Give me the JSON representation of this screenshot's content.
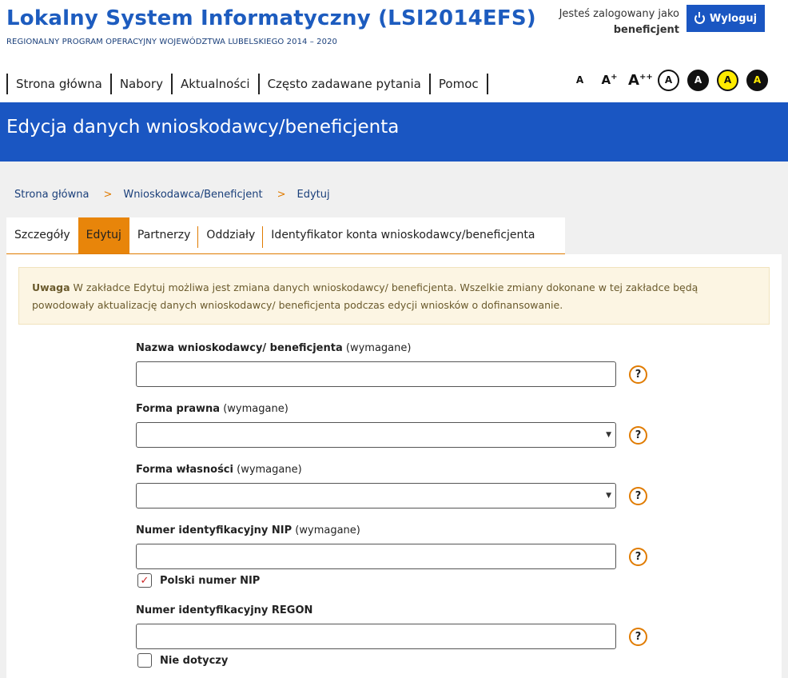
{
  "header": {
    "title": "Lokalny System Informatyczny (LSI2014EFS)",
    "subtitle": "REGIONALNY PROGRAM OPERACYJNY WOJEWÓDZTWA LUBELSKIEGO 2014 – 2020",
    "logged_in_label": "Jesteś zalogowany jako",
    "username": "beneficjent",
    "logout_label": "Wyloguj"
  },
  "nav": {
    "items": [
      "Strona główna",
      "Nabory",
      "Aktualności",
      "Często zadawane pytania",
      "Pomoc"
    ]
  },
  "accessibility": {
    "font_small": "A",
    "font_medium": "A",
    "font_medium_sup": "+",
    "font_large": "A",
    "font_large_sup": "++",
    "contrast": [
      "A",
      "A",
      "A",
      "A"
    ]
  },
  "banner": {
    "title": "Edycja danych wnioskodawcy/beneficjenta"
  },
  "breadcrumb": {
    "items": [
      "Strona główna",
      "Wnioskodawca/Beneficjent",
      "Edytuj"
    ],
    "separator": ">"
  },
  "tabs": {
    "items": [
      "Szczegóły",
      "Edytuj",
      "Partnerzy",
      "Oddziały",
      "Identyfikator konta wnioskodawcy/beneficjenta"
    ],
    "active": "Edytuj"
  },
  "alert": {
    "strong": "Uwaga",
    "text": " W zakładce Edytuj możliwa jest zmiana danych wnioskodawcy/ beneficjenta. Wszelkie zmiany dokonane w tej zakładce będą powodowały aktualizację danych wnioskodawcy/ beneficjenta podczas edycji wniosków o dofinansowanie."
  },
  "form": {
    "required_text": "(wymagane)",
    "help_icon": "?",
    "fields": {
      "name": {
        "label": "Nazwa wnioskodawcy/ beneficjenta",
        "value": ""
      },
      "legal_form": {
        "label": "Forma prawna",
        "value": ""
      },
      "ownership_form": {
        "label": "Forma własności",
        "value": ""
      },
      "nip": {
        "label": "Numer identyfikacyjny NIP",
        "value": ""
      },
      "regon": {
        "label": "Numer identyfikacyjny REGON",
        "value": ""
      }
    },
    "polish_nip": {
      "label": "Polski numer NIP",
      "checked": true
    },
    "not_applicable": {
      "label": "Nie dotyczy",
      "checked": false
    }
  },
  "colors": {
    "brand_blue": "#1a56c2",
    "accent_orange": "#e8850a",
    "alert_bg": "#fcf5e3"
  }
}
